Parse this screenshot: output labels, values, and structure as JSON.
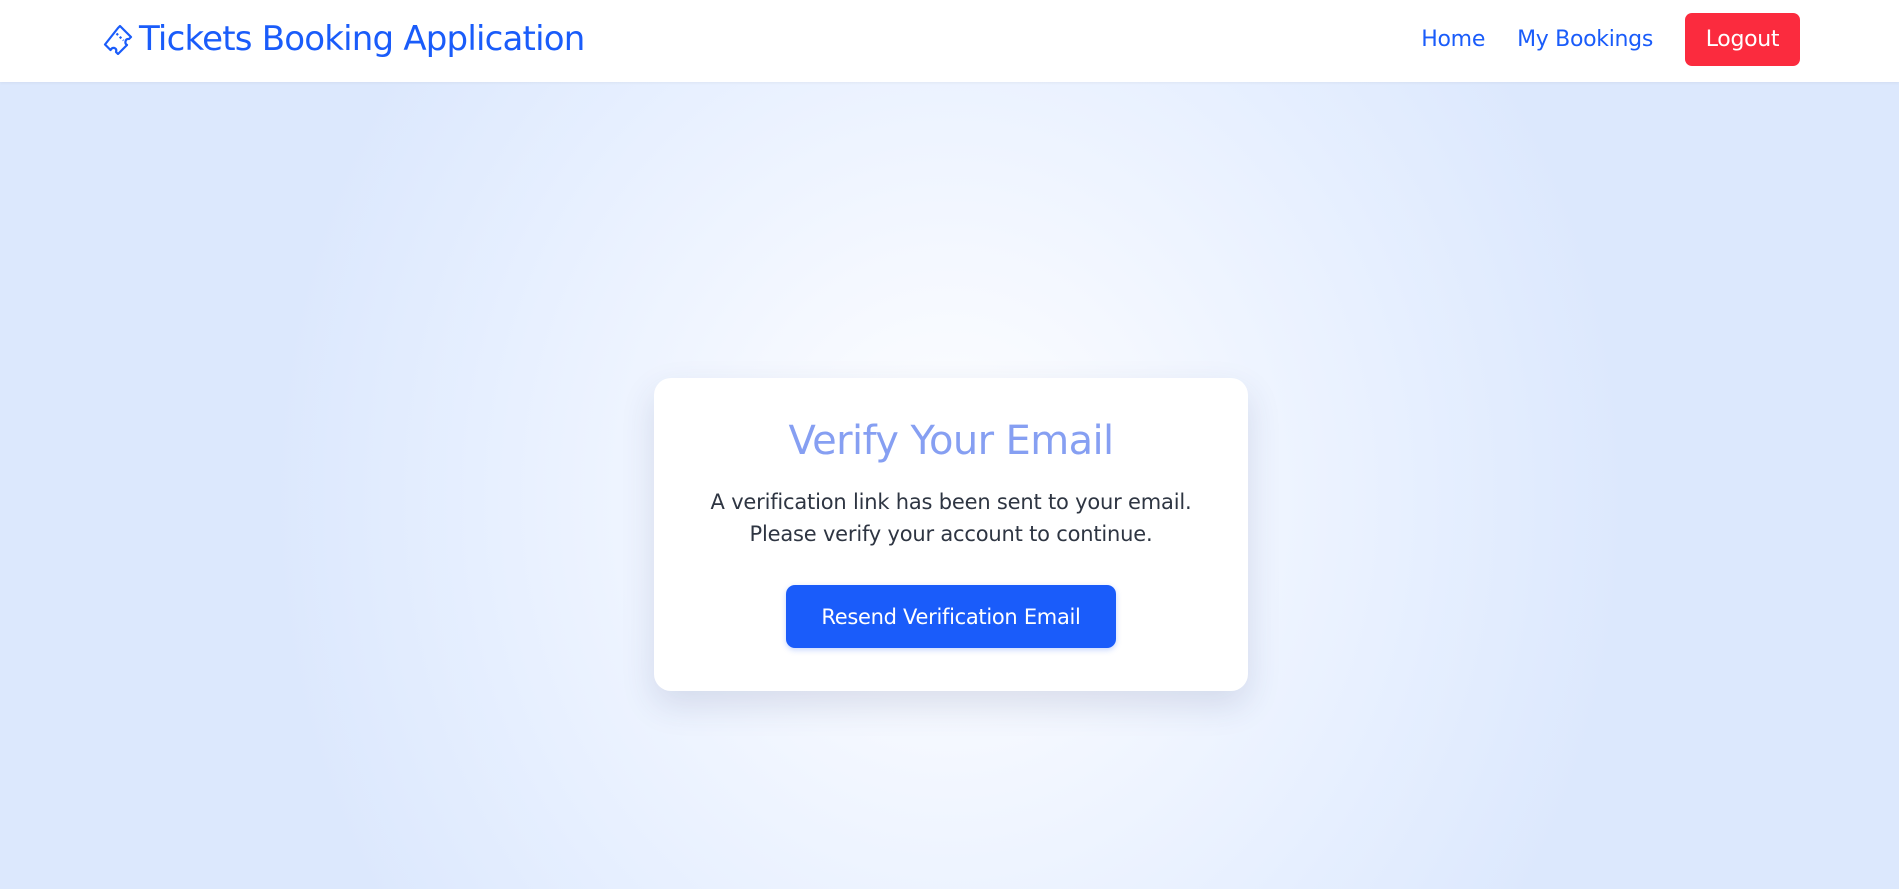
{
  "navbar": {
    "brand": {
      "icon": "ticket-icon",
      "title": "Tickets Booking Application"
    },
    "links": {
      "home": "Home",
      "my_bookings": "My Bookings"
    },
    "logout_label": "Logout"
  },
  "card": {
    "title": "Verify Your Email",
    "message_line1": "A verification link has been sent to your email.",
    "message_line2": "Please verify your account to continue.",
    "resend_label": "Resend Verification Email"
  },
  "colors": {
    "primary": "#1a5cfa",
    "danger": "#fb2b3e",
    "title": "#869ff2",
    "text": "#2e3542"
  }
}
